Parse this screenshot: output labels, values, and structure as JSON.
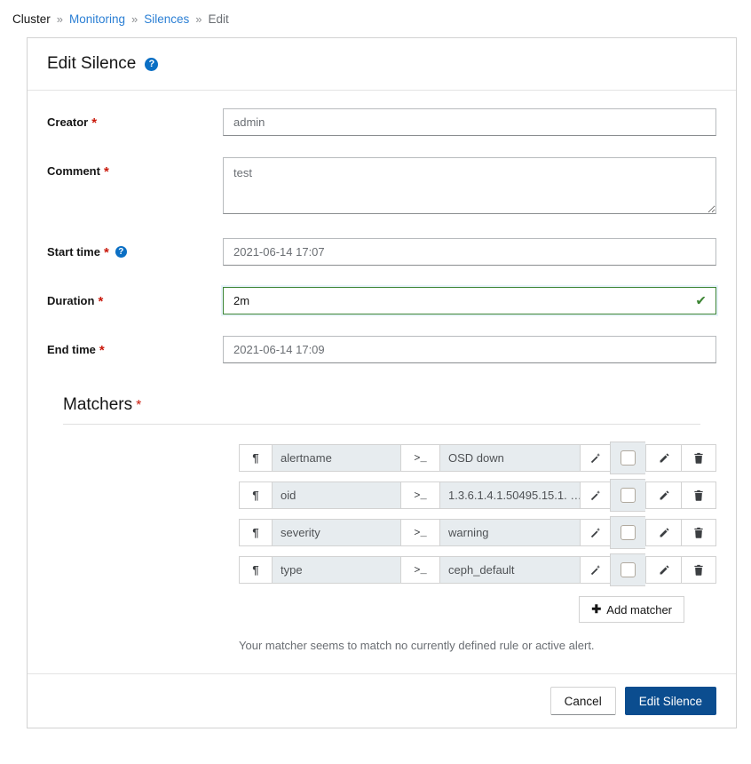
{
  "breadcrumb": {
    "separator": "»",
    "items": [
      {
        "label": "Cluster",
        "type": "text"
      },
      {
        "label": "Monitoring",
        "type": "link"
      },
      {
        "label": "Silences",
        "type": "link"
      },
      {
        "label": "Edit",
        "type": "current"
      }
    ]
  },
  "card": {
    "title": "Edit Silence",
    "help_icon": "help-circle-icon",
    "help_glyph": "?"
  },
  "form": {
    "creator": {
      "label": "Creator",
      "required_mark": "*",
      "value": "admin"
    },
    "comment": {
      "label": "Comment",
      "required_mark": "*",
      "value": "test"
    },
    "start_time": {
      "label": "Start time",
      "required_mark": "*",
      "help_glyph": "?",
      "value": "2021-06-14 17:07"
    },
    "duration": {
      "label": "Duration",
      "required_mark": "*",
      "value": "2m",
      "state": "valid",
      "valid_glyph": "✔",
      "valid_color": "#3e8635"
    },
    "end_time": {
      "label": "End time",
      "required_mark": "*",
      "value": "2021-06-14 17:09"
    }
  },
  "matchers": {
    "title": "Matchers",
    "required_mark": "*",
    "icons": {
      "name_prefix": "pilcrow-icon",
      "name_glyph": "¶",
      "operator": "terminal-prompt-icon",
      "operator_glyph": ">_",
      "wand": "magic-wand-icon",
      "edit": "pencil-icon",
      "delete": "trash-icon"
    },
    "rows": [
      {
        "name": "alertname",
        "operator": ">_",
        "value": "OSD down",
        "checked": false
      },
      {
        "name": "oid",
        "operator": ">_",
        "value": "1.3.6.1.4.1.50495.15.1. …",
        "checked": false
      },
      {
        "name": "severity",
        "operator": ">_",
        "value": "warning",
        "checked": false
      },
      {
        "name": "type",
        "operator": ">_",
        "value": "ceph_default",
        "checked": false
      }
    ],
    "add_button": {
      "label": "Add matcher",
      "icon": "plus-icon",
      "glyph": "➕"
    },
    "note": "Your matcher seems to match no currently defined rule or active alert."
  },
  "footer": {
    "cancel_label": "Cancel",
    "submit_label": "Edit Silence"
  },
  "colors": {
    "link": "#2b7fd4",
    "required": "#c9190b",
    "primary": "#0b4d8f",
    "help": "#0b6fc4",
    "valid": "#3e8635",
    "cell_bg": "#e7ecef"
  }
}
